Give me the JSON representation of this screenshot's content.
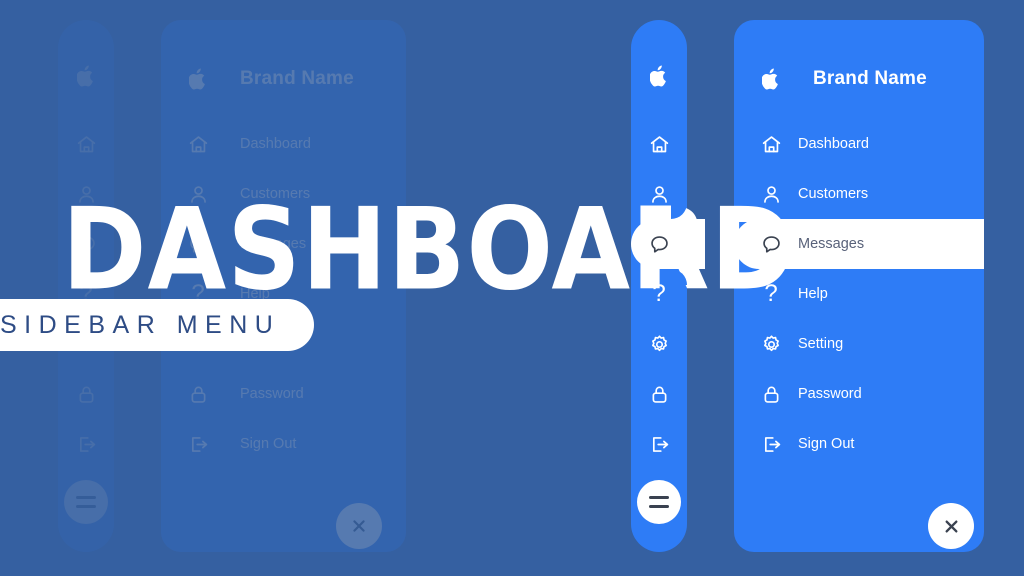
{
  "colors": {
    "background": "#3560A1",
    "panel_blue": "#2E7CF6",
    "active_pill": "#FFFFFF",
    "active_text": "#59627A",
    "headline_text": "#FFFFFF",
    "subtitle_text": "#2E4C85"
  },
  "overlay": {
    "headline": "DASHBOARD",
    "subtitle": "SIDEBAR MENU"
  },
  "sidebar": {
    "brand": {
      "logo_icon": "apple-logo-icon",
      "name": "Brand Name"
    },
    "items": [
      {
        "label": "Dashboard",
        "icon": "home-icon",
        "active": false
      },
      {
        "label": "Customers",
        "icon": "user-icon",
        "active": false
      },
      {
        "label": "Messages",
        "icon": "chat-bubble-icon",
        "active": true
      },
      {
        "label": "Help",
        "icon": "question-mark-icon",
        "active": false
      },
      {
        "label": "Setting",
        "icon": "gear-icon",
        "active": false
      },
      {
        "label": "Password",
        "icon": "lock-icon",
        "active": false
      },
      {
        "label": "Sign Out",
        "icon": "logout-icon",
        "active": false
      }
    ],
    "menu_toggle_icon": "hamburger-icon",
    "close_icon": "close-icon"
  }
}
